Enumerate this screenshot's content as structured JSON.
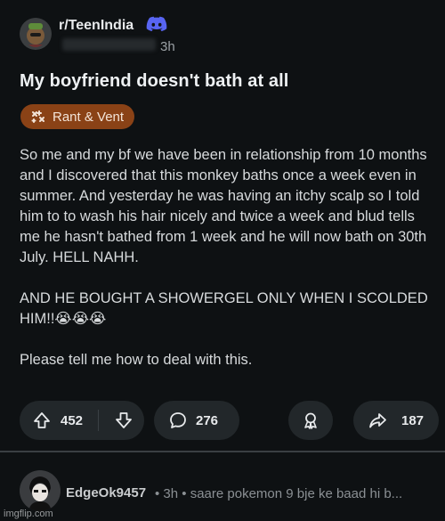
{
  "post": {
    "subreddit": "r/TeenIndia",
    "time": "3h",
    "title": "My boyfriend doesn't bath at all",
    "flair": "Rant & Vent",
    "body": [
      "So me and my bf we have been in relationship from 10 months and I discovered that this monkey baths once a week even in summer. And yesterday he was having an itchy scalp so I told him to to wash his hair nicely and twice a week and blud tells me he hasn't bathed from 1 week and he will now bath on 30th July. HELL NAHH.",
      "AND HE BOUGHT A SHOWERGEL ONLY WHEN I SCOLDED HIM!!😭😭😭",
      "Please tell me how to deal with this."
    ],
    "upvotes": "452",
    "comments": "276",
    "shares": "187"
  },
  "comment": {
    "author": "EdgeOk9457",
    "meta": "• 3h • saare pokemon 9 bje ke baad hi b..."
  },
  "watermark": "imgflip.com",
  "colors": {
    "background": "#0e1113",
    "flair_bg": "#8a4216",
    "pill_bg": "#22272a"
  }
}
